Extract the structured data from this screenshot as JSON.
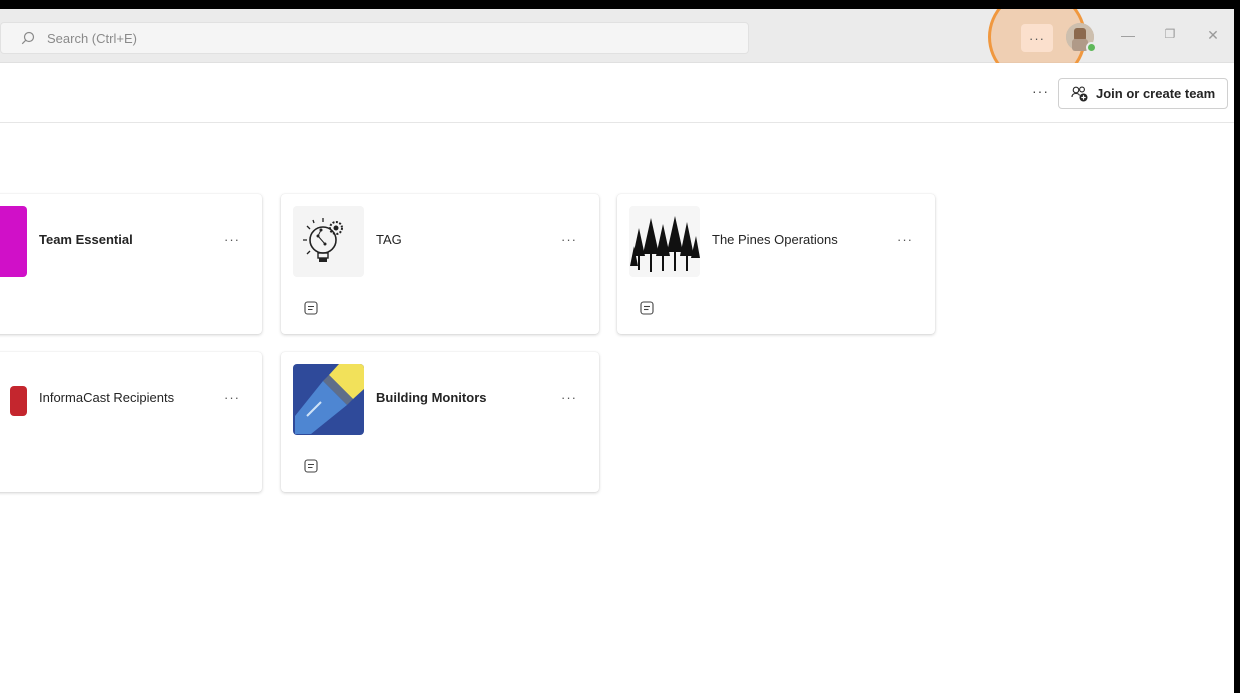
{
  "search": {
    "placeholder": "Search (Ctrl+E)"
  },
  "titlebar": {
    "more_label": "···",
    "minimize": "—",
    "restore": "❐",
    "close": "✕"
  },
  "toolbar": {
    "more_label": "···",
    "join_label": "Join or create team"
  },
  "teams": [
    {
      "name": "Team Essential",
      "bold": true,
      "thumb": "magenta-tile",
      "more": "···"
    },
    {
      "name": "TAG",
      "bold": false,
      "thumb": "lightbulb-gear-icon",
      "more": "···"
    },
    {
      "name": "The Pines Operations",
      "bold": false,
      "thumb": "pine-trees-icon",
      "more": "···"
    },
    {
      "name": "InformaCast Recipients",
      "bold": false,
      "thumb": "red-tile",
      "more": "···"
    },
    {
      "name": "Building Monitors",
      "bold": true,
      "thumb": "flashlight-icon",
      "more": "···"
    }
  ],
  "colors": {
    "accent_highlight": "#f0983f",
    "team_essential_tile": "#d010c8",
    "informacast_tile": "#c4262e",
    "building_monitors_bg": "#2f4a9a"
  }
}
